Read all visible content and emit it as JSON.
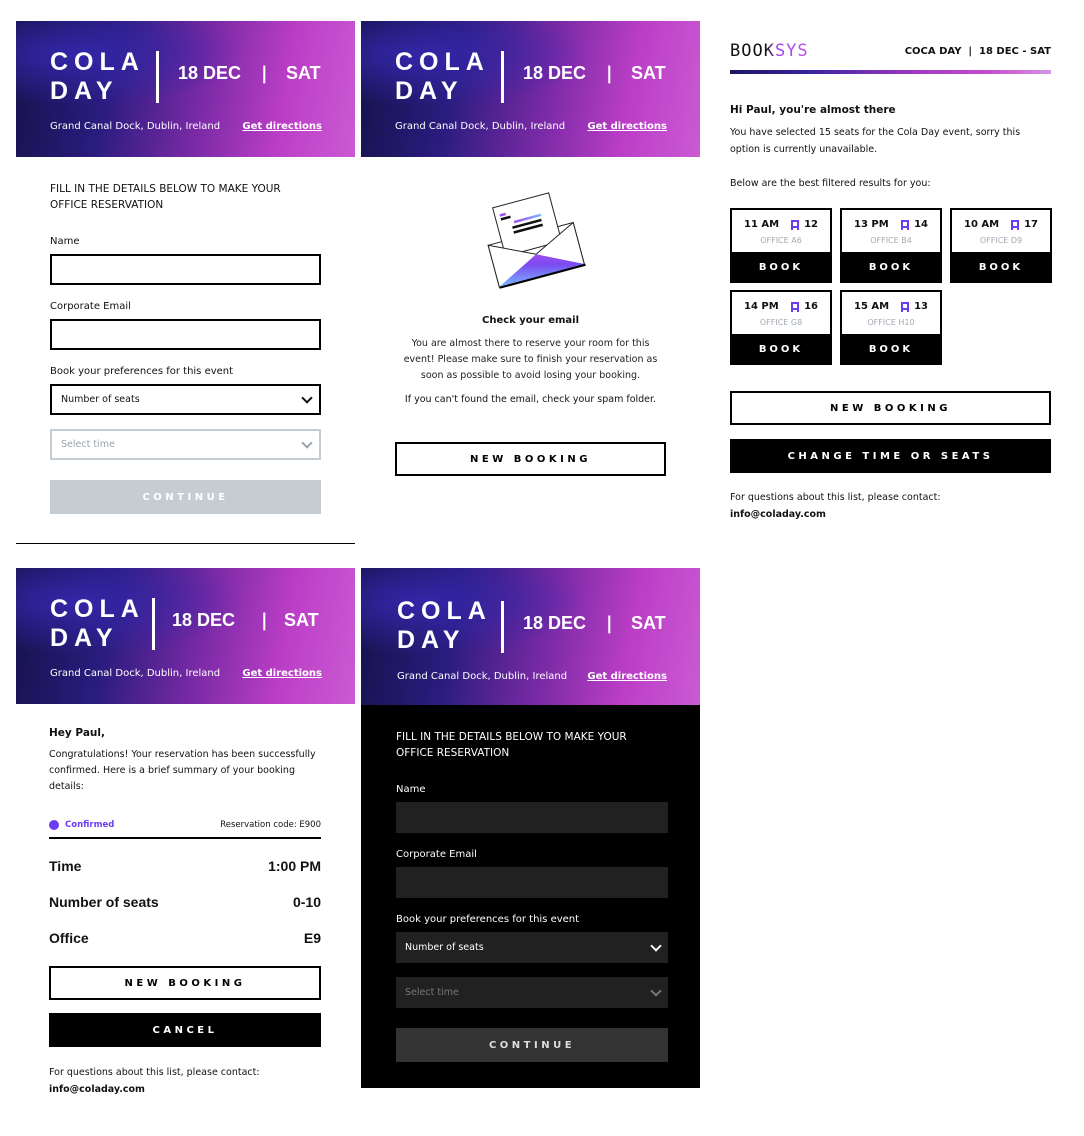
{
  "event": {
    "title_line1": "COLA",
    "title_line2": "DAY",
    "date": "18 DEC",
    "separator": "|",
    "day": "SAT",
    "address": "Grand Canal Dock, Dublin, Ireland",
    "directions": "Get directions"
  },
  "form": {
    "heading": "FILL IN THE DETAILS BELOW TO MAKE YOUR OFFICE RESERVATION",
    "name_label": "Name",
    "name_value": "",
    "email_label": "Corporate Email",
    "email_value": "",
    "prefs_label": "Book your preferences for this event",
    "seats_select": "Number of seats",
    "time_placeholder": "Select time",
    "continue": "CONTINUE"
  },
  "check_email": {
    "title": "Check your email",
    "body": "You are almost there to reserve your room for this event! Please make sure to finish your reservation as soon as possible to avoid losing your booking.",
    "spam": "If you can't found the email, check your spam folder.",
    "new_booking": "NEW BOOKING"
  },
  "booksys": {
    "logo": "BOOKSYS",
    "event_info": "COCA DAY  |  18 DEC - SAT",
    "greeting": "Hi Paul, you're almost there",
    "message": "You have selected 15 seats for the Cola Day event, sorry this option is currently unavailable.",
    "results_intro": "Below are the best filtered results for you:",
    "results": [
      {
        "time": "11 AM",
        "seats": "12",
        "office": "OFFICE A6",
        "action": "BOOK"
      },
      {
        "time": "13 PM",
        "seats": "14",
        "office": "OFFICE B4",
        "action": "BOOK"
      },
      {
        "time": "10 AM",
        "seats": "17",
        "office": "OFFICE D9",
        "action": "BOOK"
      },
      {
        "time": "14 PM",
        "seats": "16",
        "office": "OFFICE G8",
        "action": "BOOK"
      },
      {
        "time": "15 AM",
        "seats": "13",
        "office": "OFFICE H10",
        "action": "BOOK"
      }
    ],
    "new_booking": "NEW BOOKING",
    "change": "CHANGE TIME OR SEATS",
    "contact": "For questions about this list, please contact:",
    "email": "info@coladay.com"
  },
  "confirmation": {
    "greeting": "Hey Paul,",
    "message": "Congratulations! Your reservation has been successfully confirmed. Here is a brief summary of your booking details:",
    "status": "Confirmed",
    "code": "Reservation code: E900",
    "details": [
      {
        "label": "Time",
        "value": "1:00 PM"
      },
      {
        "label": "Number of seats",
        "value": "0-10"
      },
      {
        "label": "Office",
        "value": "E9"
      }
    ],
    "new_booking": "NEW BOOKING",
    "cancel": "CANCEL",
    "contact": "For questions about this list, please contact:",
    "email": "info@coladay.com"
  },
  "colors": {
    "accent": "#6a3df0",
    "gradient_start": "#15124a",
    "gradient_end": "#cb5ad3",
    "disabled": "#c5ccd2"
  }
}
